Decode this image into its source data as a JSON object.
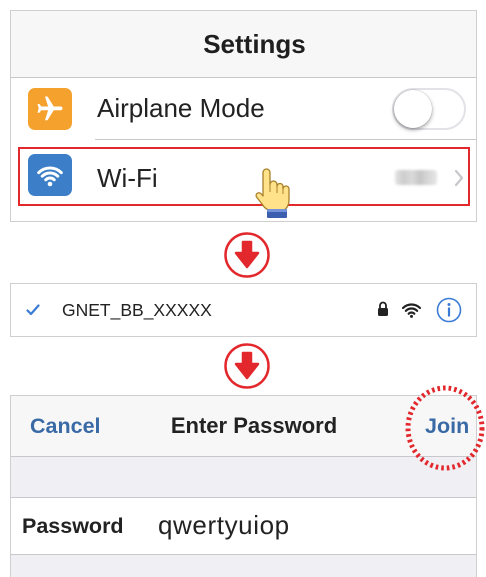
{
  "colors": {
    "highlight": "#e2282c",
    "link": "#3a6aa6",
    "accent": "#3a7bd5",
    "airplane_icon": "#f5a12e",
    "wifi_icon": "#3d7ec8",
    "group_bg": "#efeff4"
  },
  "step1": {
    "title": "Settings",
    "rows": [
      {
        "icon": "airplane-icon",
        "label": "Airplane Mode",
        "toggle_on": false
      },
      {
        "icon": "wifi-icon",
        "label": "Wi-Fi",
        "accessory_icon": "chevron-right-icon",
        "highlighted": true
      }
    ],
    "cursor_icon": "hand-pointer-icon"
  },
  "step_arrow_icon": "down-arrow-icon",
  "step2": {
    "connected_icon": "checkmark-icon",
    "network_name": "GNET_BB_XXXXX",
    "status_icons": [
      "lock-icon",
      "wifi-icon",
      "info-icon"
    ]
  },
  "step3": {
    "cancel_label": "Cancel",
    "title": "Enter Password",
    "join_label": "Join",
    "join_highlighted": true,
    "field_label": "Password",
    "field_value": "qwertyuiop"
  }
}
